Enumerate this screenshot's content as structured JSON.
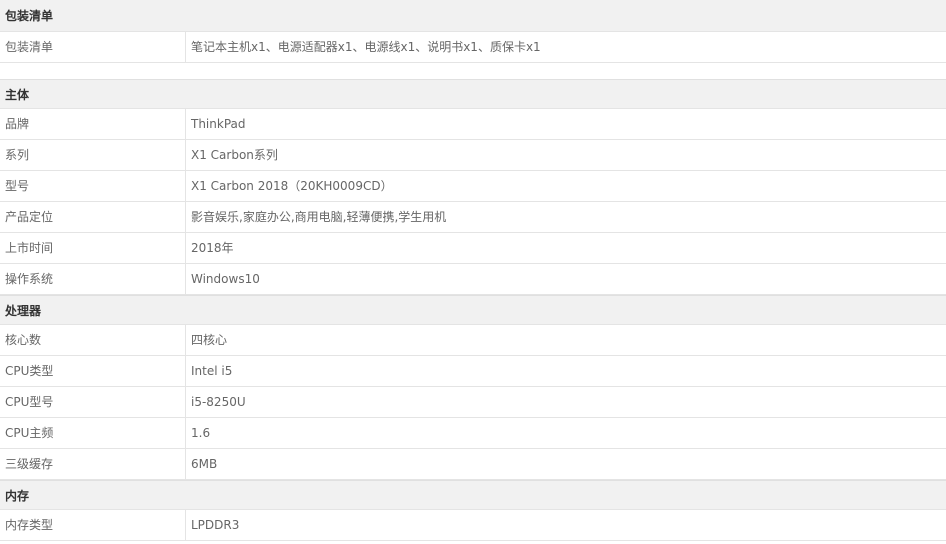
{
  "sections": [
    {
      "title": "包装清单",
      "rows": [
        {
          "label": "包装清单",
          "value": "笔记本主机x1、电源适配器x1、电源线x1、说明书x1、质保卡x1"
        }
      ]
    },
    {
      "title": "主体",
      "rows": [
        {
          "label": "品牌",
          "value": "ThinkPad"
        },
        {
          "label": "系列",
          "value": "X1 Carbon系列"
        },
        {
          "label": "型号",
          "value": "X1 Carbon 2018（20KH0009CD）"
        },
        {
          "label": "产品定位",
          "value": "影音娱乐,家庭办公,商用电脑,轻薄便携,学生用机"
        },
        {
          "label": "上市时间",
          "value": "2018年"
        },
        {
          "label": "操作系统",
          "value": "Windows10"
        }
      ]
    },
    {
      "title": "处理器",
      "rows": [
        {
          "label": "核心数",
          "value": "四核心"
        },
        {
          "label": "CPU类型",
          "value": "Intel i5"
        },
        {
          "label": "CPU型号",
          "value": "i5-8250U"
        },
        {
          "label": "CPU主频",
          "value": "1.6"
        },
        {
          "label": "三级缓存",
          "value": "6MB"
        }
      ]
    },
    {
      "title": "内存",
      "rows": [
        {
          "label": "内存类型",
          "value": "LPDDR3"
        }
      ]
    }
  ]
}
